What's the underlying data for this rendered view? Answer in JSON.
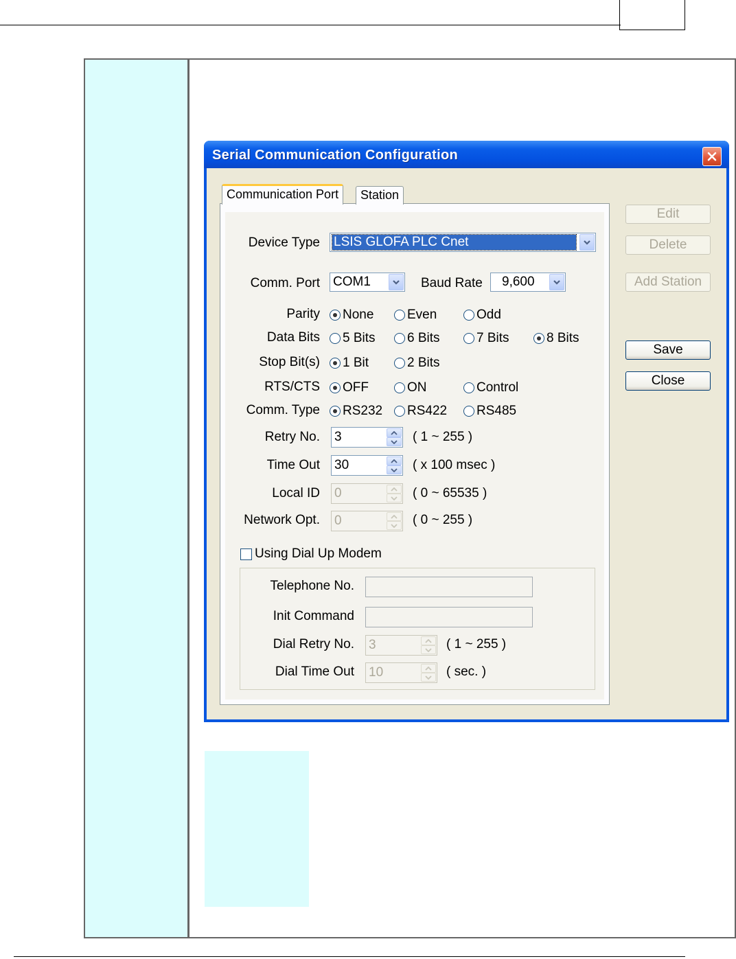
{
  "dialog": {
    "title": "Serial Communication Configuration",
    "tabs": [
      {
        "label": "Communication Port",
        "active": true
      },
      {
        "label": "Station",
        "active": false
      }
    ],
    "device_type": {
      "label": "Device Type",
      "value": "LSIS GLOFA PLC Cnet"
    },
    "comm_port": {
      "label": "Comm. Port",
      "value": "COM1"
    },
    "baud_rate": {
      "label": "Baud Rate",
      "value": "9,600"
    },
    "parity": {
      "label": "Parity",
      "options": [
        "None",
        "Even",
        "Odd"
      ],
      "selected": "None"
    },
    "data_bits": {
      "label": "Data Bits",
      "options": [
        "5 Bits",
        "6 Bits",
        "7 Bits",
        "8 Bits"
      ],
      "selected": "8 Bits"
    },
    "stop_bits": {
      "label": "Stop Bit(s)",
      "options": [
        "1 Bit",
        "2 Bits"
      ],
      "selected": "1 Bit"
    },
    "rts_cts": {
      "label": "RTS/CTS",
      "options": [
        "OFF",
        "ON",
        "Control"
      ],
      "selected": "OFF"
    },
    "comm_type": {
      "label": "Comm. Type",
      "options": [
        "RS232",
        "RS422",
        "RS485"
      ],
      "selected": "RS232"
    },
    "retry_no": {
      "label": "Retry No.",
      "value": "3",
      "range": "( 1 ~ 255 )"
    },
    "time_out": {
      "label": "Time Out",
      "value": "30",
      "range": "( x 100 msec )"
    },
    "local_id": {
      "label": "Local ID",
      "value": "0",
      "range": "( 0 ~ 65535 )"
    },
    "network_opt": {
      "label": "Network Opt.",
      "value": "0",
      "range": "( 0 ~ 255 )"
    },
    "dial_up": {
      "label": "Using Dial Up Modem",
      "checked": false
    },
    "telephone_no": {
      "label": "Telephone No.",
      "value": ""
    },
    "init_command": {
      "label": "Init Command",
      "value": ""
    },
    "dial_retry_no": {
      "label": "Dial Retry No.",
      "value": "3",
      "range": "( 1 ~ 255 )"
    },
    "dial_time_out": {
      "label": "Dial Time Out",
      "value": "10",
      "range": "( sec. )"
    },
    "buttons": {
      "edit": "Edit",
      "delete": "Delete",
      "add_station": "Add Station",
      "save": "Save",
      "close": "Close"
    }
  },
  "colors": {
    "title_bar": "#0451e0",
    "client_bg": "#ece9d8",
    "side_cell": "#dcfdfd",
    "selection": "#316ac5"
  }
}
